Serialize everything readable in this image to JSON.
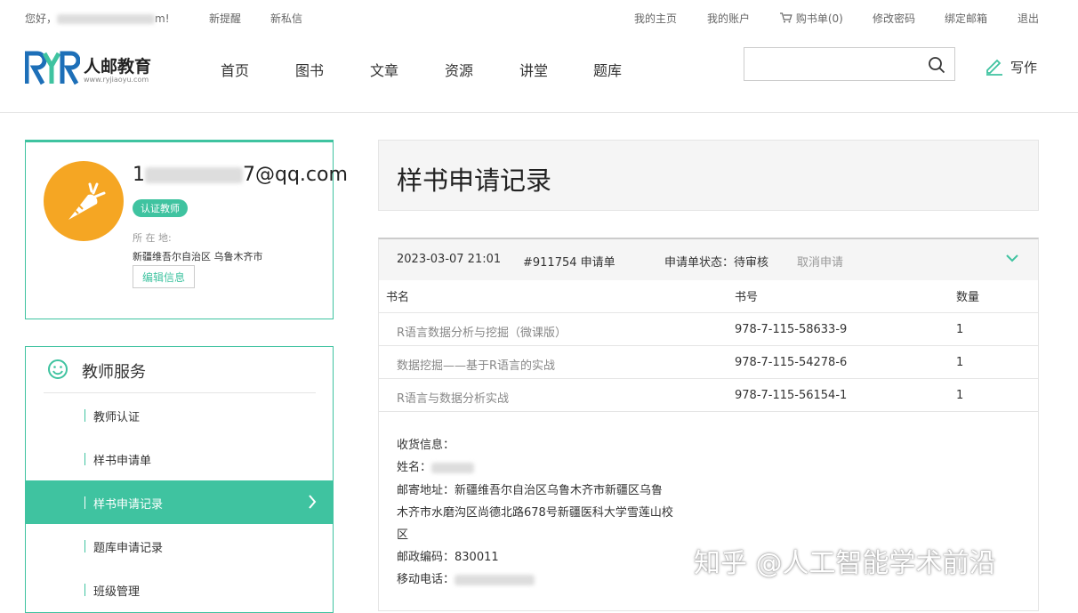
{
  "topbar": {
    "greeting": "您好，",
    "greeting_tail": "m!",
    "new_notice": "新提醒",
    "new_message": "新私信",
    "my_home": "我的主页",
    "my_account": "我的账户",
    "cart": "购书单(0)",
    "change_password": "修改密码",
    "bind_email": "绑定邮箱",
    "logout": "退出"
  },
  "header": {
    "logo_text": "人邮教育",
    "logo_sub": "www.ryjiaoyu.com",
    "nav": [
      "首页",
      "图书",
      "文章",
      "资源",
      "讲堂",
      "题库"
    ],
    "search_placeholder": "",
    "write_label": "写作"
  },
  "profile": {
    "username_prefix": "1",
    "username_suffix": "7@qq.com",
    "badge": "认证教师",
    "location_label": "所 在 地:",
    "location_value": "新疆维吾尔自治区 乌鲁木齐市",
    "edit_label": "编辑信息"
  },
  "service": {
    "title": "教师服务",
    "items": [
      {
        "label": "教师认证"
      },
      {
        "label": "样书申请单"
      },
      {
        "label": "样书申请记录"
      },
      {
        "label": "题库申请记录"
      },
      {
        "label": "班级管理"
      }
    ]
  },
  "main": {
    "title": "样书申请记录",
    "record": {
      "date": "2023-03-07 21:01",
      "order_no": "#911754 申请单",
      "status": "申请单状态：待审核",
      "cancel": "取消申请",
      "columns": [
        "书名",
        "书号",
        "数量"
      ],
      "rows": [
        {
          "name": "R语言数据分析与挖掘（微课版）",
          "isbn": "978-7-115-58633-9",
          "qty": "1"
        },
        {
          "name": "数据挖掘——基于R语言的实战",
          "isbn": "978-7-115-54278-6",
          "qty": "1"
        },
        {
          "name": "R语言与数据分析实战",
          "isbn": "978-7-115-56154-1",
          "qty": "1"
        }
      ],
      "shipping": {
        "label": "收货信息：",
        "name_label": "姓名：",
        "address_line1": "邮寄地址：新疆维吾尔自治区乌鲁木齐市新疆区乌鲁",
        "address_line2": "木齐市水磨沟区尚德北路678号新疆医科大学雪莲山校",
        "address_line3": "区",
        "postcode": "邮政编码：830011",
        "phone_label": "移动电话："
      }
    }
  },
  "watermark": "知乎 @人工智能学术前沿",
  "colors": {
    "accent": "#3fc3a0",
    "avatar": "#f5a623",
    "logo_blue": "#1d6fb8"
  }
}
